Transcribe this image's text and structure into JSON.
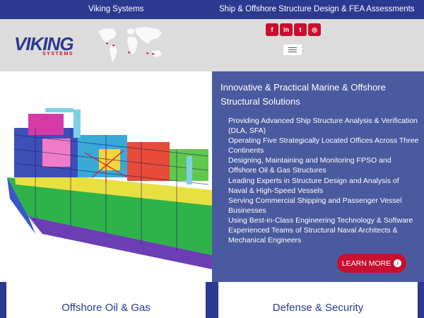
{
  "topbar": {
    "left_text": "Viking Systems",
    "right_text": "Ship & Offshore Structure Design & FEA Assessments"
  },
  "header": {
    "logo_text": "VIKING",
    "logo_subtext": "SYSTEMS",
    "social": [
      {
        "icon": "facebook-icon",
        "glyph": "f"
      },
      {
        "icon": "linkedin-icon",
        "glyph": "in"
      },
      {
        "icon": "twitter-icon",
        "glyph": "t"
      },
      {
        "icon": "instagram-icon",
        "glyph": "◎"
      }
    ]
  },
  "hero": {
    "title": "Innovative & Practical Marine & Offshore Structural Solutions",
    "items": [
      "Providing Advanced Ship Structure Analysis & Verification (DLA, SFA)",
      "Operating Five Strategically Located Offices Across Three Continents",
      "Designing, Maintaining and Monitoring FPSO and Offshore Oil & Gas Structures",
      "Leading Experts in Structure Design and Analysis of Naval & High-Speed Vessels",
      "Serving Commercial Shipping and Passenger Vessel Businesses",
      "Using Best-in-Class Engineering Technology & Software",
      "Experienced Teams of Structural Naval Architects & Mechanical Engineers"
    ],
    "button_label": "LEARN MORE"
  },
  "sectors": [
    {
      "label": "Offshore Oil & Gas"
    },
    {
      "label": "Defense & Security"
    }
  ],
  "colors": {
    "brand_blue": "#2b3990",
    "panel_blue": "#4a5a9e",
    "accent_red": "#c8102e"
  }
}
